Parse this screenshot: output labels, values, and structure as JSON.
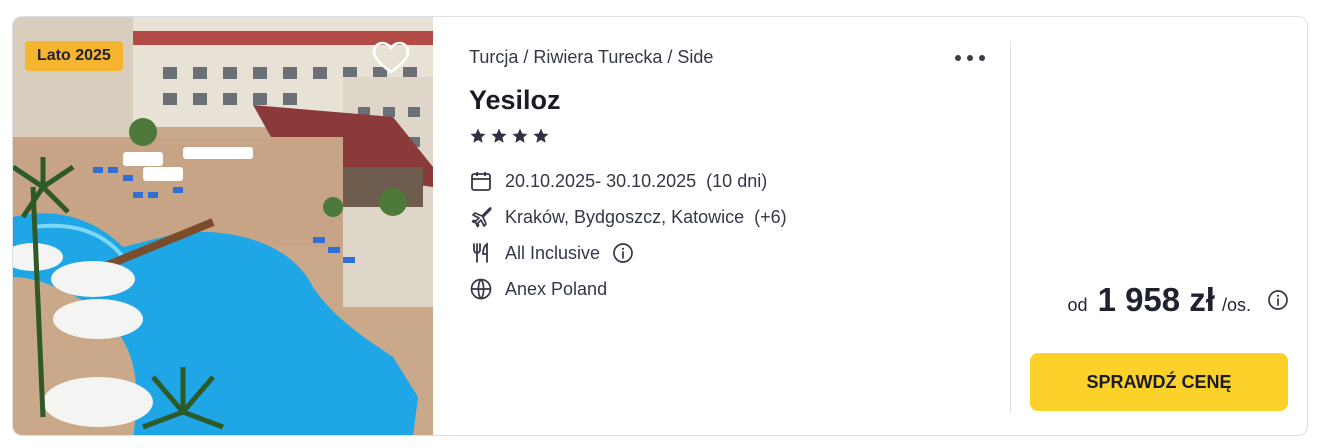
{
  "offer": {
    "badge": "Lato 2025",
    "breadcrumb": "Turcja / Riwiera Turecka / Side",
    "hotel_name": "Yesiloz",
    "stars": 4,
    "dates": "20.10.2025- 30.10.2025",
    "duration": "(10 dni)",
    "departure": "Kraków, Bydgoszcz, Katowice",
    "departure_more": "(+6)",
    "board": "All Inclusive",
    "operator": "Anex Poland",
    "price_prefix": "od",
    "price": "1 958 zł",
    "price_suffix": "/os.",
    "cta_label": "SPRAWDŹ CENĘ"
  },
  "icons": {
    "favorite": "heart-icon",
    "more": "more-dots-icon",
    "dates": "calendar-icon",
    "departure": "plane-icon",
    "board": "utensils-icon",
    "board_info": "info-icon",
    "operator": "globe-icon",
    "price_info": "info-icon"
  },
  "colors": {
    "badge": "#f6b52e",
    "cta": "#fcd12a",
    "star": "#2d3142",
    "text": "#1f2230"
  }
}
